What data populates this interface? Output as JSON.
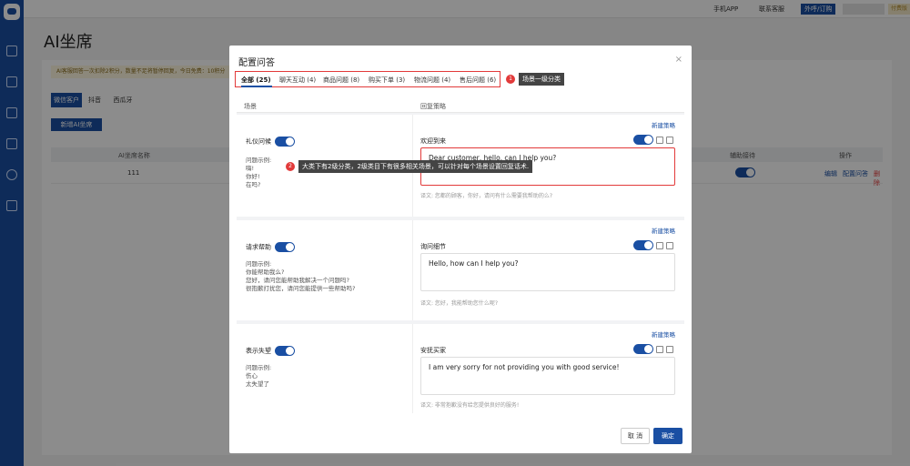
{
  "topbar": {
    "mobile_app": "手机APP",
    "contact_service": "联系客服",
    "outbound": "外呼/订购",
    "paid_badge": "付费版"
  },
  "page": {
    "title": "AI坐席",
    "notice": "AI客服回答一次扣除2积分，数量不足将暂停回复，今日免费：10积分",
    "segments": [
      "微信客户",
      "抖音",
      "西瓜牙"
    ],
    "add_button": "新增AI坐席",
    "table": {
      "headers": [
        "AI坐席名称",
        "辅助接待",
        "操作"
      ],
      "row": {
        "name": "111",
        "actions": [
          "编辑",
          "配置问答",
          "删除"
        ]
      }
    }
  },
  "modal": {
    "title": "配置问答",
    "close": "×",
    "tabs": [
      "全部 (25)",
      "聊天互动 (4)",
      "商品问题 (8)",
      "购买下单 (3)",
      "物流问题 (4)",
      "售后问题 (6)"
    ],
    "callout1": "场景一级分类",
    "callout1_num": "1",
    "callout2": "大类下有2级分类，2级类目下有很多相关场景，可以针对每个场景设置回复话术.",
    "callout2_num": "2",
    "col_scene": "场景",
    "col_strategy": "回复策略",
    "new_strategy": "新建策略",
    "examples_label": "问题示例:",
    "blocks": [
      {
        "scene": "礼仪问候",
        "examples": "嗨!\n你好!\n在吗?",
        "strategy_name": "欢迎到来",
        "reply": "Dear customer, hello, can I help you?",
        "translation": "译文: 您都的顾客，你好，请问有什么需要我帮助的么?"
      },
      {
        "scene": "请求帮助",
        "examples": "你能帮助我么?\n您好，请问您能帮助我解决一个问题吗?\n很抱歉打扰您，请问您能提供一些帮助吗?",
        "strategy_name": "询问细节",
        "reply": "Hello, how can I help you?",
        "translation": "译文: 您好，我能帮助您什么呢?"
      },
      {
        "scene": "表示失望",
        "examples": "伤心\n太失望了",
        "strategy_name": "安抚买家",
        "reply": "I am very sorry for not providing you with good service!",
        "translation": "译文: 非常抱歉没有给您提供良好的服务!"
      }
    ],
    "cancel": "取 消",
    "confirm": "确定"
  }
}
